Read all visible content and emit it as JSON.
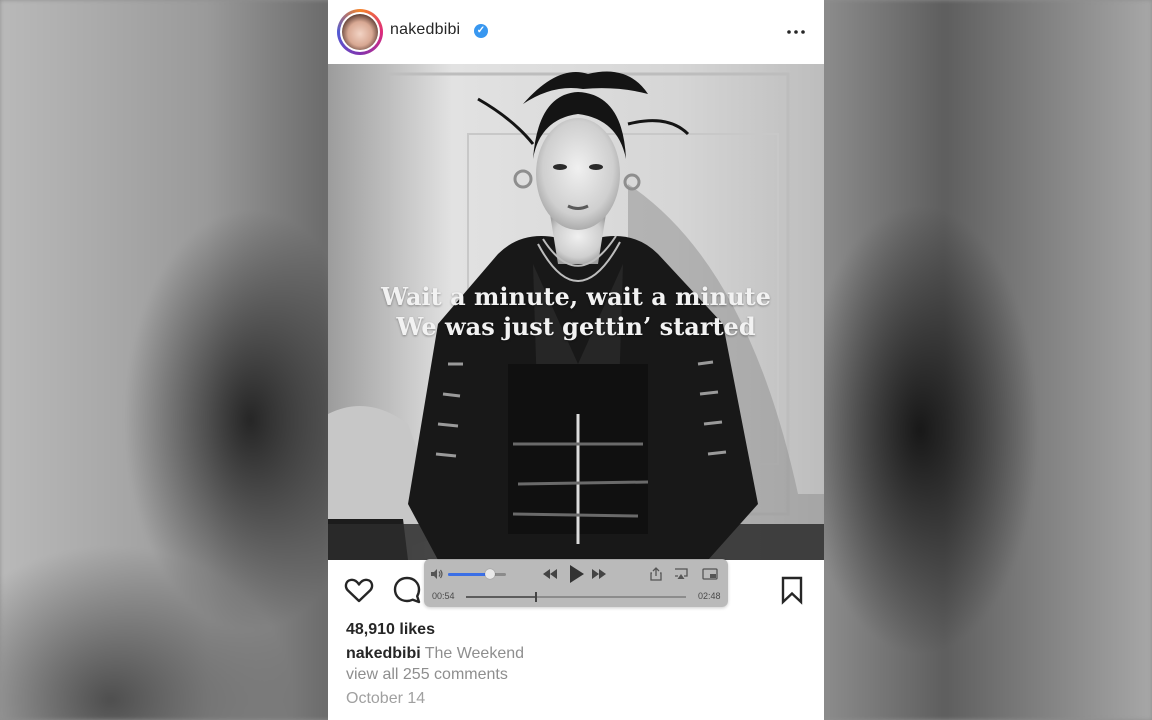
{
  "post": {
    "username": "nakedbibi",
    "verified_badge": "✓",
    "overlay_lyrics": [
      "Wait a minute, wait a minute",
      "We was just gettin’ started"
    ],
    "likes": "48,910 likes",
    "caption_user": "nakedbibi",
    "caption_text": "The Weekend",
    "comments_link": "view all 255 comments",
    "date": "October 14"
  },
  "player": {
    "current_time": "00:54",
    "total_time": "02:48",
    "progress_fraction": 0.32,
    "volume_fraction": 0.72
  },
  "icons": {
    "more": "more-horizontal-icon",
    "like": "heart-icon",
    "comment": "comment-icon",
    "save": "bookmark-icon",
    "volume": "volume-icon",
    "rewind": "rewind-icon",
    "play": "play-icon",
    "forward": "fast-forward-icon",
    "share": "share-icon",
    "airplay": "airplay-icon",
    "pip": "picture-in-picture-icon"
  },
  "colors": {
    "verified": "#3897f0",
    "volume_fill": "#3b6fe6",
    "text_primary": "#262626",
    "text_secondary": "#8e8e8e"
  }
}
